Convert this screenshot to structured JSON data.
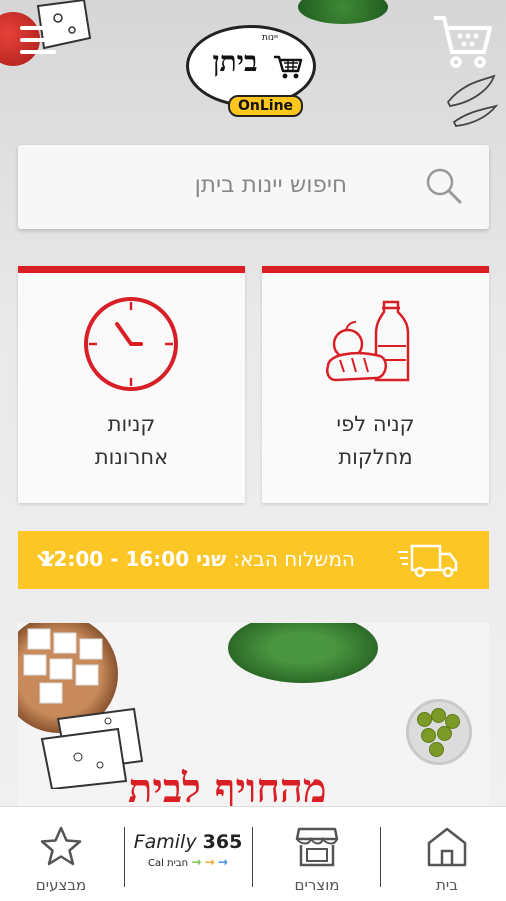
{
  "header": {
    "logo_small": "יינות",
    "logo_main": "ביתן",
    "logo_badge": "OnLine",
    "menu_icon": "hamburger-menu-icon",
    "cart_icon": "shopping-cart-icon"
  },
  "search": {
    "placeholder": "חיפוש יינות ביתן",
    "icon": "search-icon"
  },
  "tiles": [
    {
      "label_line1": "קניה לפי",
      "label_line2": "מחלקות",
      "icon": "groceries-icon"
    },
    {
      "label_line1": "קניות",
      "label_line2": "אחרונות",
      "icon": "clock-icon"
    }
  ],
  "delivery": {
    "label": "המשלוח הבא:",
    "value": "שני 16:00 - 12:00",
    "icon": "delivery-truck-icon"
  },
  "banner": {
    "title": "מהחויף לבית"
  },
  "bottom_nav": {
    "home": "בית",
    "products": "מוצרים",
    "family_brand": "Family",
    "family_number": "365",
    "family_sub": "Cal חבית",
    "deals": "מבצעים"
  },
  "colors": {
    "accent_red": "#d81f26",
    "delivery_yellow": "#fdc627",
    "logo_yellow": "#ffc61e"
  }
}
